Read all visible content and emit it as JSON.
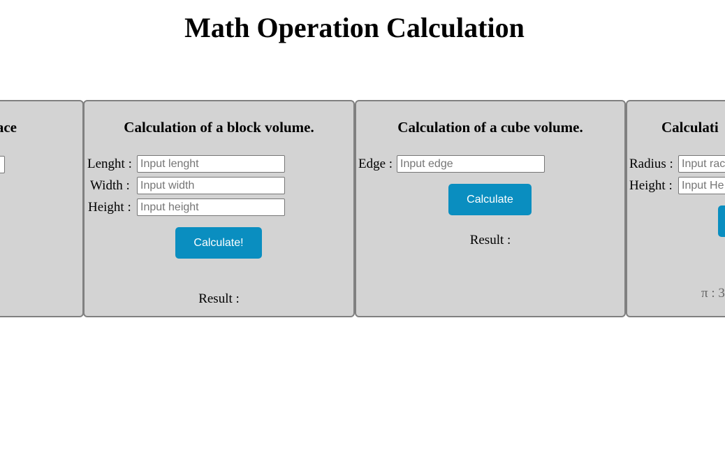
{
  "page": {
    "title": "Math Operation Calculation"
  },
  "cards": {
    "partial_left": {
      "heading_fragment": "ace"
    },
    "block": {
      "heading": "Calculation of a block volume.",
      "length_label": "Lenght :",
      "length_placeholder": "Input lenght",
      "width_label": "Width :",
      "width_placeholder": "Input width",
      "height_label": "Height :",
      "height_placeholder": "Input height",
      "button_label": "Calculate!",
      "result_label": "Result :"
    },
    "cube": {
      "heading": "Calculation of a cube volume.",
      "edge_label": "Edge :",
      "edge_placeholder": "Input edge",
      "button_label": "Calculate",
      "result_label": "Result :"
    },
    "partial_right": {
      "heading_fragment": "Calculati",
      "radius_label": "Radius :",
      "radius_placeholder": "Input rac",
      "height_label": "Height :",
      "height_placeholder": "Input He",
      "pi_fragment": "π : 3"
    }
  },
  "colors": {
    "card_background": "#d3d3d3",
    "card_border": "#808080",
    "button_background": "#0a8ec0",
    "button_text": "#ffffff"
  }
}
